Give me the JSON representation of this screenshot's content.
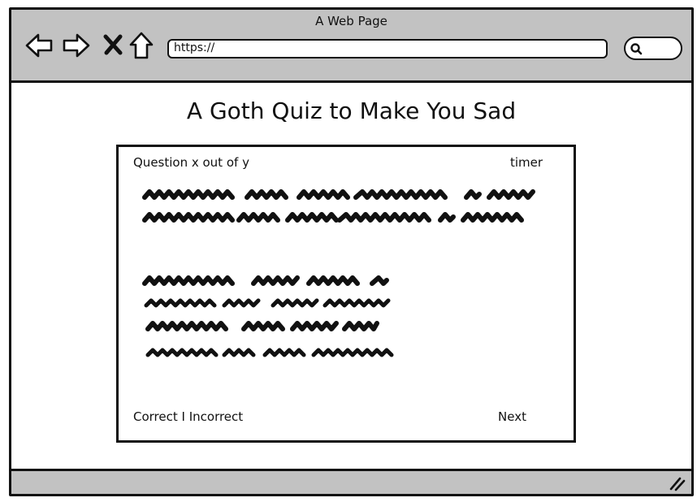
{
  "window": {
    "title": "A Web Page"
  },
  "browser": {
    "url": "https://",
    "back_icon": "arrow-left-icon",
    "forward_icon": "arrow-right-icon",
    "stop_icon": "close-icon",
    "home_icon": "home-icon",
    "search_icon": "search-icon"
  },
  "page": {
    "heading": "A Goth Quiz to Make You Sad",
    "quiz": {
      "question_counter": "Question x out of y",
      "timer": "timer",
      "feedback": "Correct I Incorrect",
      "next_label": "Next"
    }
  },
  "status_bar": {
    "resize_icon": "resize-grip-icon"
  }
}
